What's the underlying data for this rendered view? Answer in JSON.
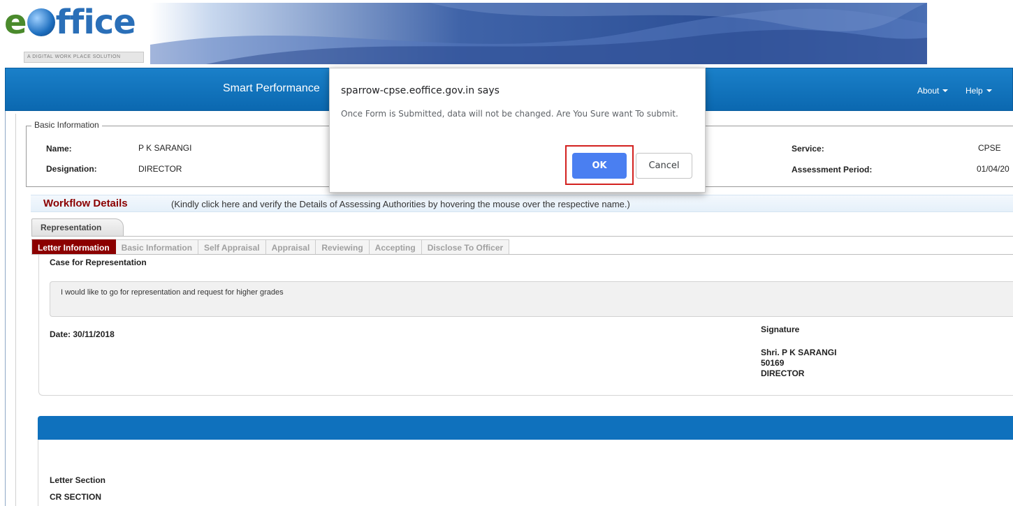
{
  "banner": {
    "logo_e": "e",
    "logo_rest": "ffice",
    "tagline": "A DIGITAL WORK PLACE SOLUTION"
  },
  "navbar": {
    "title": "Smart Performance",
    "about": "About",
    "help": "Help"
  },
  "basic_info": {
    "legend": "Basic Information",
    "name_label": "Name:",
    "name_value": "P K SARANGI",
    "designation_label": "Designation:",
    "designation_value": "DIRECTOR",
    "service_label": "Service:",
    "service_value": "CPSE",
    "period_label": "Assessment Period:",
    "period_value": "01/04/20"
  },
  "workflow": {
    "title": "Workflow Details",
    "hint": "(Kindly click here and verify the Details of Assessing Authorities by hovering the mouse over the respective name.)"
  },
  "representation_tab": "Representation",
  "subtabs": [
    "Letter Information",
    "Basic Information",
    "Self Appraisal",
    "Appraisal",
    "Reviewing",
    "Accepting",
    "Disclose To Officer"
  ],
  "letter": {
    "case_title": "Case for Representation",
    "case_text": "I would like to go for representation and request for higher grades",
    "date": "Date: 30/11/2018",
    "signature_label": "Signature",
    "signer_name": "Shri. P K SARANGI",
    "signer_id": "50169",
    "signer_designation": "DIRECTOR"
  },
  "letter_section": {
    "label": "Letter Section",
    "value": "CR SECTION"
  },
  "dialog": {
    "title": "sparrow-cpse.eoffice.gov.in says",
    "message": "Once Form is Submitted, data will not be changed. Are You Sure want To submit.",
    "ok_label": "OK",
    "cancel_label": "Cancel"
  },
  "colors": {
    "navbar_blue": "#0b68b0",
    "active_tab": "#8b0000",
    "workflow_title": "#8b0000",
    "ok_button": "#4a7ff1",
    "highlight_box": "#d3211f"
  }
}
